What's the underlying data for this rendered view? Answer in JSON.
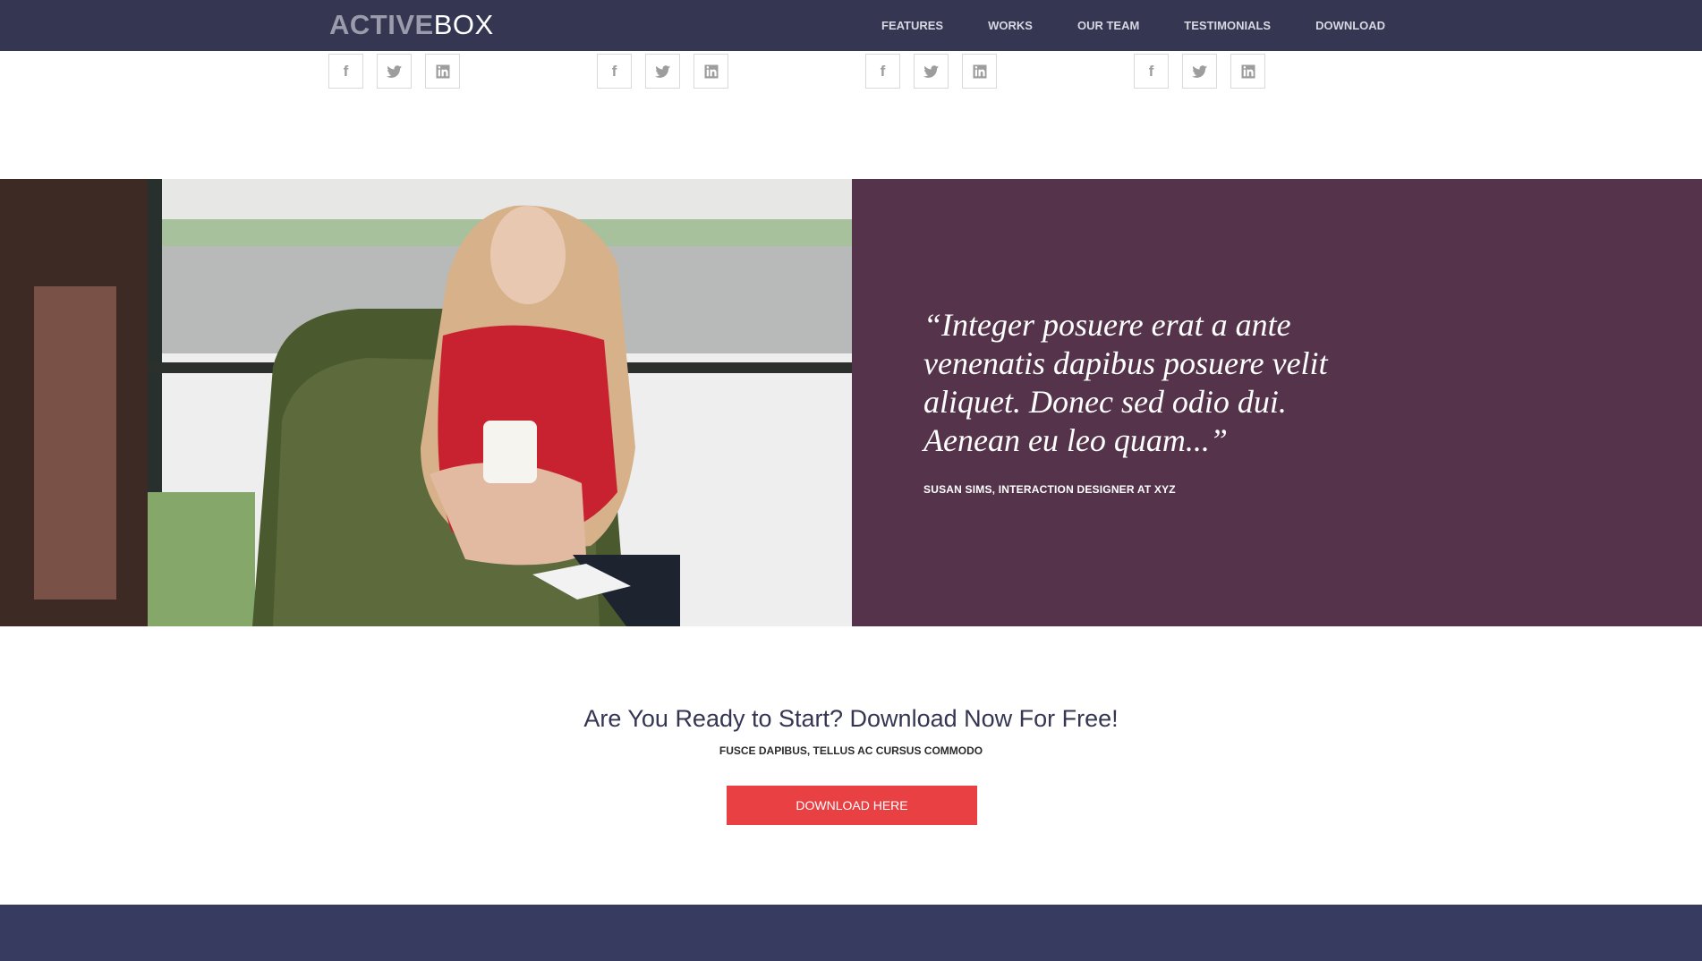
{
  "brand": {
    "part1": "ACTIVE",
    "part2": "BOX"
  },
  "nav": [
    {
      "label": "FEATURES"
    },
    {
      "label": "WORKS"
    },
    {
      "label": "OUR TEAM"
    },
    {
      "label": "TESTIMONIALS"
    },
    {
      "label": "DOWNLOAD"
    }
  ],
  "social_icons": [
    "facebook-icon",
    "twitter-icon",
    "linkedin-icon"
  ],
  "testimonial": {
    "quote": "“Integer posuere erat a ante venenatis dapibus posuere velit aliquet. Donec sed odio dui. Aenean eu leo quam...”",
    "author": "SUSAN SIMS, INTERACTION DESIGNER AT XYZ"
  },
  "cta": {
    "title": "Are You Ready to Start? Download Now For Free!",
    "subtitle": "FUSCE DAPIBUS, TELLUS AC CURSUS COMMODO",
    "button": "DOWNLOAD HERE"
  },
  "colors": {
    "navbar": "#343652",
    "quote_panel": "#55344b",
    "cta_button": "#e94044",
    "footer": "#383b60"
  }
}
